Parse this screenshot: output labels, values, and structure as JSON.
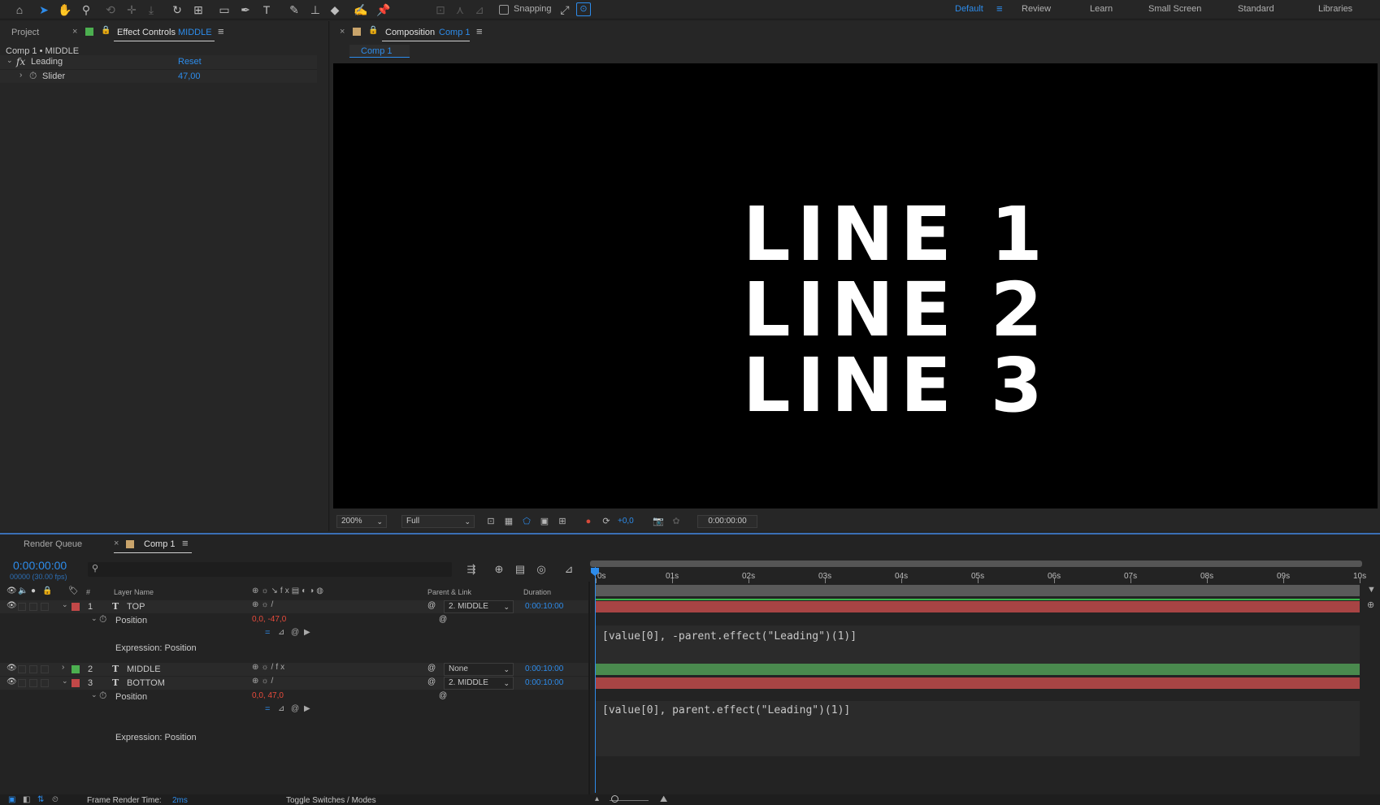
{
  "toolbar": {
    "snapping_label": "Snapping",
    "workspaces": [
      "Default",
      "Review",
      "Learn",
      "Small Screen",
      "Standard",
      "Libraries"
    ],
    "active_workspace": "Default"
  },
  "effect_controls": {
    "tab_project": "Project",
    "tab_label": "Effect Controls",
    "tab_layer": "MIDDLE",
    "breadcrumb": "Comp 1 • MIDDLE",
    "effect_name": "Leading",
    "reset_label": "Reset",
    "param_name": "Slider",
    "param_value": "47,00"
  },
  "composition": {
    "tab_label": "Composition",
    "tab_comp": "Comp 1",
    "subtab": "Comp 1",
    "lines": [
      "LINE 1",
      "LINE 2",
      "LINE 3"
    ],
    "zoom": "200%",
    "resolution": "Full",
    "exposure": "+0,0",
    "timecode": "0:00:00:00"
  },
  "timeline": {
    "tab_render_queue": "Render Queue",
    "tab_comp": "Comp 1",
    "current_time": "0:00:00:00",
    "fps_info": "00000 (30.00 fps)",
    "search_placeholder": "",
    "col_number": "#",
    "col_layer_name": "Layer Name",
    "col_parent": "Parent & Link",
    "col_duration": "Duration",
    "ruler_ticks": [
      "0s",
      "01s",
      "02s",
      "03s",
      "04s",
      "05s",
      "06s",
      "07s",
      "08s",
      "09s",
      "10s"
    ],
    "layers": [
      {
        "num": "1",
        "name": "TOP",
        "color": "#c24848",
        "parent": "2. MIDDLE",
        "duration": "0:00:10:00",
        "prop": "Position",
        "prop_value": "0,0, -47,0",
        "expr_label": "Expression: Position",
        "expression": "[value[0], -parent.effect(\"Leading\")(1)]"
      },
      {
        "num": "2",
        "name": "MIDDLE",
        "color": "#4caf50",
        "parent": "None",
        "duration": "0:00:10:00"
      },
      {
        "num": "3",
        "name": "BOTTOM",
        "color": "#c24848",
        "parent": "2. MIDDLE",
        "duration": "0:00:10:00",
        "prop": "Position",
        "prop_value": "0,0, 47,0",
        "expr_label": "Expression: Position",
        "expression": "[value[0], parent.effect(\"Leading\")(1)]"
      }
    ],
    "status_render_label": "Frame Render Time:",
    "status_render_value": "2ms",
    "toggle_label": "Toggle Switches / Modes"
  },
  "colors": {
    "accent": "#2d8ceb",
    "layer_red": "#a84444",
    "layer_green": "#4a8a4e",
    "property_red": "#e84b3c"
  }
}
